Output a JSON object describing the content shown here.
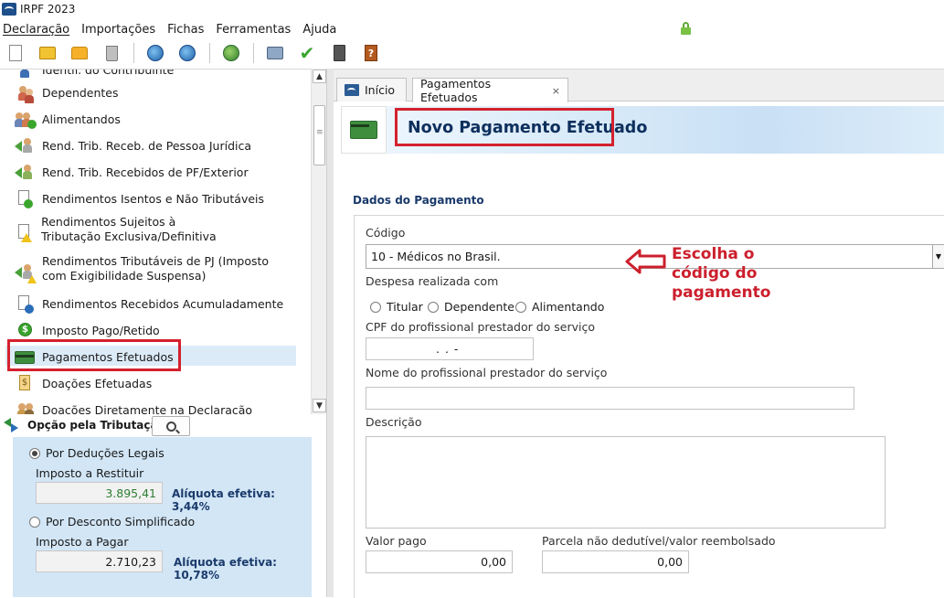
{
  "window": {
    "title": "IRPF 2023"
  },
  "menu": [
    "Declaração",
    "Importações",
    "Fichas",
    "Ferramentas",
    "Ajuda"
  ],
  "toolbar_icons": [
    "new-file-icon",
    "open-folder-icon",
    "folder-icon",
    "trash-icon",
    "globe-transmit-icon",
    "globe-receive-icon",
    "globe-world-icon",
    "printer-icon",
    "check-icon",
    "calculator-icon",
    "help-book-icon"
  ],
  "nav": {
    "partial_top": "Identif. do Contribuinte",
    "items": [
      "Dependentes",
      "Alimentandos",
      "Rend. Trib. Receb. de Pessoa Jurídica",
      "Rend. Trib. Recebidos de PF/Exterior",
      "Rendimentos Isentos e Não Tributáveis",
      "Rendimentos Sujeitos à Tributação Exclusiva/Definitiva",
      "Rendimentos Tributáveis de PJ (Imposto com Exigibilidade Suspensa)",
      "Rendimentos Recebidos Acumuladamente",
      "Imposto Pago/Retido",
      "Pagamentos Efetuados",
      "Doações Efetuadas",
      "Doações Diretamente na Declaração"
    ],
    "selected": "Pagamentos Efetuados"
  },
  "opcao": {
    "title": "Opção pela Tributação:",
    "deducoes": {
      "label": "Por Deduções Legais",
      "sub": "Imposto a Restituir",
      "value": "3.895,41",
      "aliquota": "Alíquota efetiva: 3,44%",
      "selected": true
    },
    "simplificado": {
      "label": "Por Desconto Simplificado",
      "sub": "Imposto a Pagar",
      "value": "2.710,23",
      "aliquota": "Alíquota efetiva: 10,78%",
      "selected": false
    }
  },
  "tabs": [
    {
      "label": "Início",
      "active": false
    },
    {
      "label": "Pagamentos Efetuados",
      "active": true,
      "close": "×"
    }
  ],
  "form": {
    "banner_title": "Novo Pagamento Efetuado",
    "section": "Dados do Pagamento",
    "codigo_label": "Código",
    "codigo_value": "10 - Médicos no Brasil.",
    "despesa_label": "Despesa realizada com",
    "despesa_options": [
      "Titular",
      "Dependente",
      "Alimentando"
    ],
    "cpf_label": "CPF do profissional prestador do serviço",
    "cpf_value": ".   .   -",
    "nome_label": "Nome do profissional prestador do serviço",
    "nome_value": "",
    "descricao_label": "Descrição",
    "valor_pago_label": "Valor pago",
    "valor_pago_value": "0,00",
    "parcela_label": "Parcela não dedutível/valor reembolsado",
    "parcela_value": "0,00"
  },
  "annotation": {
    "lines": [
      "Escolha o",
      "código do",
      "pagamento"
    ],
    "color": "#cc1f2c"
  },
  "colors": {
    "highlight_box": "#d4212e",
    "selected_row": "#dcebf8",
    "opcao_bg": "#d2e6f6"
  }
}
